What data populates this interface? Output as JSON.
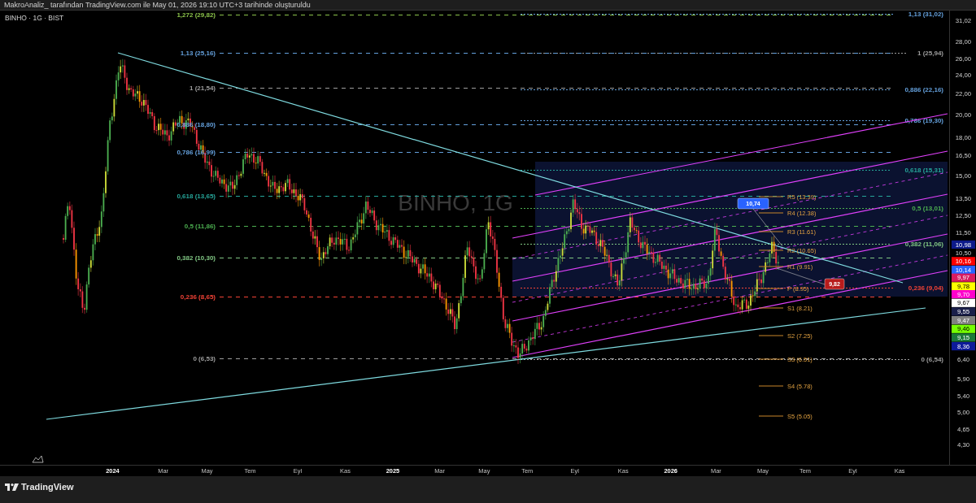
{
  "caption": "MakroAnaliz_ tarafından TradingView.com ile May 01, 2026 19:10 UTC+3 tarihinde oluşturuldu",
  "chart": {
    "symbol": "BINHO · 1G · BIST",
    "watermark": "BINHO, 1G",
    "fib_left": [
      {
        "label": "1,272 (29,82)",
        "color": "#8bc34a"
      },
      {
        "label": "1,13 (25,16)",
        "color": "#64a0dc"
      },
      {
        "label": "1 (21,54)",
        "color": "#9e9e9e"
      },
      {
        "label": "0,886 (18,80)",
        "color": "#64a0dc"
      },
      {
        "label": "0,786 (16,99)",
        "color": "#64a0dc"
      },
      {
        "label": "0,618 (13,65)",
        "color": "#26a69a"
      },
      {
        "label": "0,5 (11,86)",
        "color": "#4caf50"
      },
      {
        "label": "0,382 (10,30)",
        "color": "#81c784"
      },
      {
        "label": "0,236 (8,65)",
        "color": "#f44336"
      },
      {
        "label": "0 (6,53)",
        "color": "#9e9e9e"
      }
    ],
    "fib_right": [
      {
        "label": "1,13 (31,02)",
        "color": "#64a0dc"
      },
      {
        "label": "1 (25,94)",
        "color": "#9e9e9e"
      },
      {
        "label": "0,886 (22,16)",
        "color": "#64a0dc"
      },
      {
        "label": "0,786 (19,30)",
        "color": "#64a0dc"
      },
      {
        "label": "0,618 (15,31)",
        "color": "#26a69a"
      },
      {
        "label": "0,5 (13,01)",
        "color": "#4caf50"
      },
      {
        "label": "0,382 (11,06)",
        "color": "#81c784"
      },
      {
        "label": "0,236 (9,04)",
        "color": "#f44336"
      },
      {
        "label": "0 (6,54)",
        "color": "#9e9e9e"
      }
    ],
    "pivots": [
      "R5 (13.39)",
      "R4 (12.38)",
      "R3 (11.61)",
      "R2 (10.65)",
      "R1 (9.91)",
      "P (8.95)",
      "S1 (8.21)",
      "S2 (7.25)",
      "S3 (6.51)",
      "S4 (5.78)",
      "S5 (5.05)"
    ],
    "callouts": [
      {
        "text": "10,74",
        "color": "#2962ff"
      },
      {
        "text": "9,82",
        "color": "#b71c1c"
      }
    ],
    "price_scale": [
      {
        "text": "31,02"
      },
      {
        "text": "28,00"
      },
      {
        "text": "26,00"
      },
      {
        "text": "24,00"
      },
      {
        "text": "22,00"
      },
      {
        "text": "20,00"
      },
      {
        "text": "18,00"
      },
      {
        "text": "16,50"
      },
      {
        "text": "15,00"
      },
      {
        "text": "13,50"
      },
      {
        "text": "12,50"
      },
      {
        "text": "11,50"
      },
      {
        "text": "10,98",
        "color": "#0d1a8a"
      },
      {
        "text": "10,50"
      },
      {
        "text": "10,16",
        "color": "#ff0000"
      },
      {
        "text": "10,14",
        "color": "#2962ff"
      },
      {
        "text": "9,97",
        "color": "#d81b60"
      },
      {
        "text": "9,78",
        "color": "#ffff00"
      },
      {
        "text": "9,70",
        "color": "#ff00cc"
      },
      {
        "text": "9,67",
        "color": "#ffffff"
      },
      {
        "text": "9,55",
        "color": "#1a1f4a"
      },
      {
        "text": "9,47",
        "color": "#808080"
      },
      {
        "text": "9,46",
        "color": "#76ff03"
      },
      {
        "text": "9,15",
        "color": "#1b7a3a"
      },
      {
        "text": "8,36",
        "color": "#0d1a9a"
      },
      {
        "text": "6,40"
      },
      {
        "text": "5,90"
      },
      {
        "text": "5,40"
      },
      {
        "text": "5,00"
      },
      {
        "text": "4,65"
      },
      {
        "text": "4,30"
      }
    ],
    "time_axis": [
      {
        "text": "2024",
        "bold": true
      },
      {
        "text": "Mar",
        "bold": false
      },
      {
        "text": "May",
        "bold": false
      },
      {
        "text": "Tem",
        "bold": false
      },
      {
        "text": "Eyl",
        "bold": false
      },
      {
        "text": "Kas",
        "bold": false
      },
      {
        "text": "2025",
        "bold": true
      },
      {
        "text": "Mar",
        "bold": false
      },
      {
        "text": "May",
        "bold": false
      },
      {
        "text": "Tem",
        "bold": false
      },
      {
        "text": "Eyl",
        "bold": false
      },
      {
        "text": "Kas",
        "bold": false
      },
      {
        "text": "2026",
        "bold": true
      },
      {
        "text": "Mar",
        "bold": false
      },
      {
        "text": "May",
        "bold": false
      },
      {
        "text": "Tem",
        "bold": false
      },
      {
        "text": "Eyl",
        "bold": false
      },
      {
        "text": "Kas",
        "bold": false
      }
    ]
  },
  "footer": {
    "brand": "TradingView"
  }
}
